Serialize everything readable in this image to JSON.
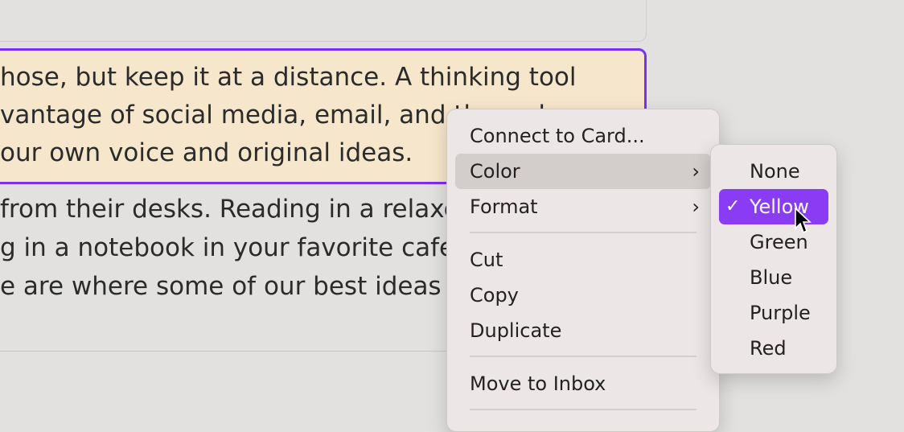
{
  "document": {
    "selected_card_lines": [
      "hose, but keep it at a distance. A thinking tool",
      "vantage of social media, email, and the web",
      "our own voice and original ideas."
    ],
    "card_lines": [
      "from their desks. Reading in a relaxed",
      "g in a notebook in your favorite cafe,",
      "e are where some of our best ideas ar"
    ]
  },
  "context_menu": {
    "items": [
      {
        "label": "Connect to Card..."
      },
      {
        "label": "Color",
        "has_submenu": true,
        "active": true
      },
      {
        "label": "Format",
        "has_submenu": true
      },
      {
        "label": "Cut"
      },
      {
        "label": "Copy"
      },
      {
        "label": "Duplicate"
      },
      {
        "label": "Move to Inbox"
      }
    ],
    "chevron": "›",
    "check": "✓"
  },
  "color_submenu": {
    "items": [
      "None",
      "Yellow",
      "Green",
      "Blue",
      "Purple",
      "Red"
    ],
    "selected": "Yellow"
  },
  "colors": {
    "selection_border": "#7b2ef5",
    "selected_card_bg": "#f6e7cc",
    "highlight": "#8a3cf4"
  }
}
